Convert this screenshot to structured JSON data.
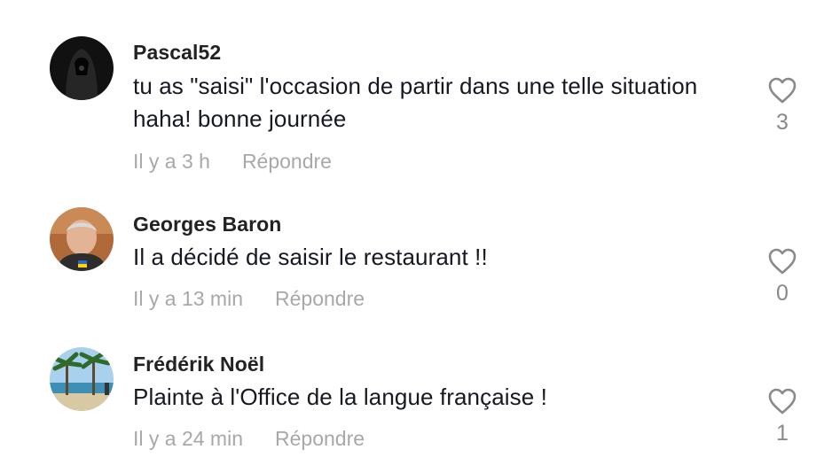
{
  "comments": [
    {
      "username": "Pascal52",
      "text": "tu as \"saisi\" l'occasion de partir dans une telle situation haha! bonne journée",
      "time": "Il y a 3 h",
      "reply": "Répondre",
      "likes": "3",
      "avatar": "dark-hooded-figure-avatar"
    },
    {
      "username": "Georges Baron",
      "text": "Il a décidé de saisir le restaurant !!",
      "time": "Il y a 13 min",
      "reply": "Répondre",
      "likes": "0",
      "avatar": "man-portrait-avatar"
    },
    {
      "username": "Frédérik Noël",
      "text": "Plainte à l'Office de la langue française !",
      "time": "Il y a 24 min",
      "reply": "Répondre",
      "likes": "1",
      "avatar": "palm-beach-avatar"
    }
  ],
  "colors": {
    "username": "#222222",
    "text": "#161823",
    "meta": "#a8a8a8",
    "heart": "#8a8a8a"
  },
  "icons": {
    "like": "heart-outline-icon"
  }
}
